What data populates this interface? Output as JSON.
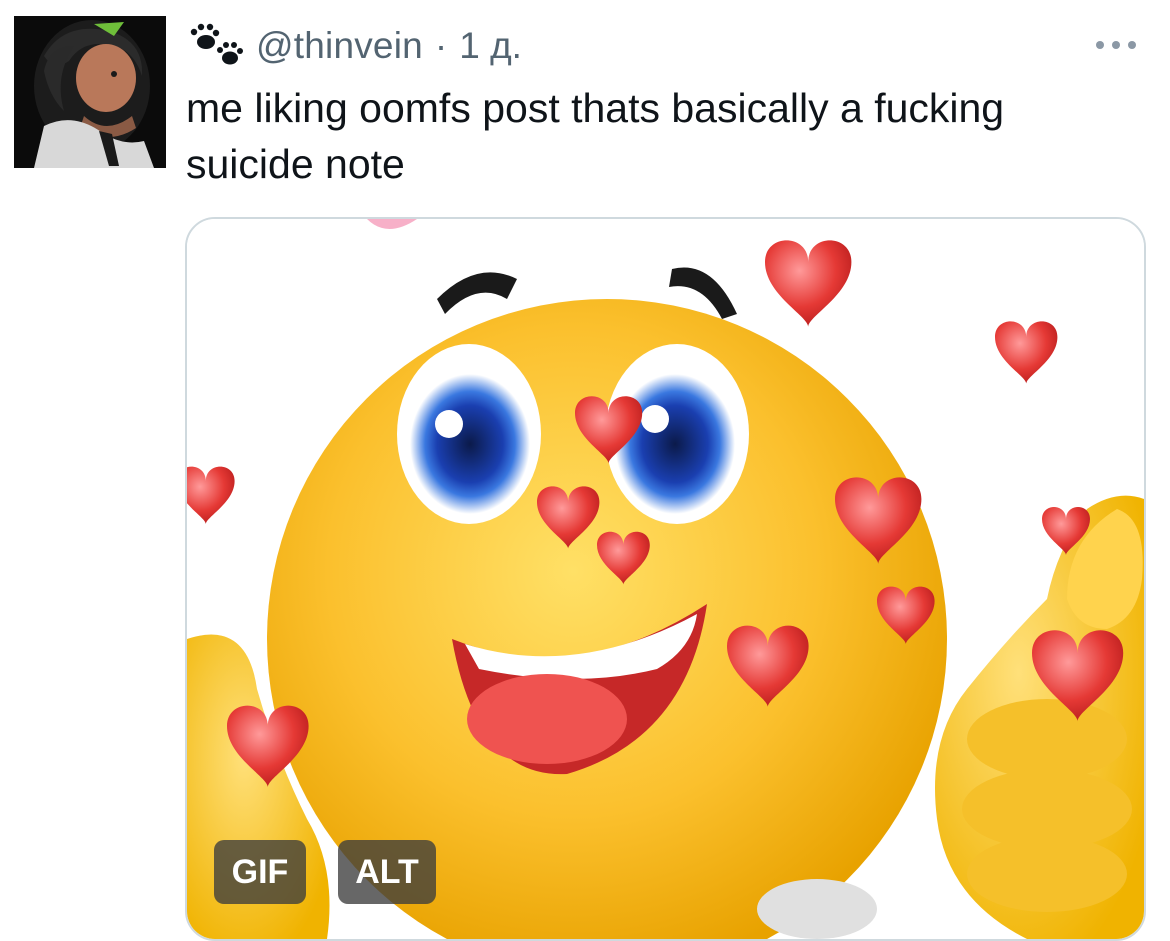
{
  "tweet": {
    "handle": "@thinvein",
    "separator": "·",
    "time": "1 д.",
    "text": "me liking oomfs post thats basically a fucking suicide note",
    "name_icon": "paw-prints-icon",
    "more_icon": "more-dots-icon"
  },
  "media": {
    "type": "gif",
    "gif_badge": "GIF",
    "alt_badge": "ALT",
    "subject": "smiley-thumbs-up-hearts"
  },
  "colors": {
    "muted_text": "#536471",
    "text": "#0f1419",
    "border": "#cfd9de",
    "badge_bg": "#3c3c3c"
  }
}
